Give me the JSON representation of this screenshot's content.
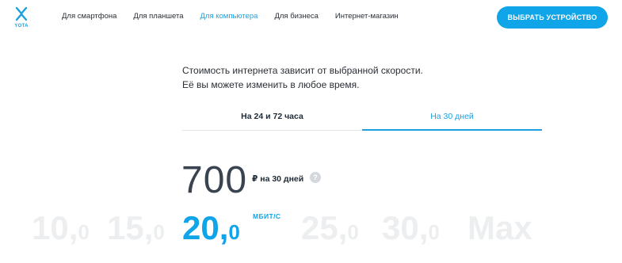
{
  "logo": {
    "text": "YOTA"
  },
  "nav": {
    "items": [
      {
        "label": "Для смартфона",
        "active": false
      },
      {
        "label": "Для планшета",
        "active": false
      },
      {
        "label": "Для компьютера",
        "active": true
      },
      {
        "label": "Для бизнеса",
        "active": false
      },
      {
        "label": "Интернет-магазин",
        "active": false
      }
    ],
    "cta": "ВЫБРАТЬ УСТРОЙСТВО"
  },
  "intro": {
    "line1": "Стоимость интернета зависит от выбранной скорости.",
    "line2": "Её вы можете изменить в любое время."
  },
  "tabs": {
    "tab1": "На 24 и 72 часа",
    "tab2": "На 30 дней",
    "selected": "tab2"
  },
  "price": {
    "value": "700",
    "currency": "₽",
    "period": "на 30 дней",
    "help": "?"
  },
  "speed": {
    "options": [
      {
        "whole": "",
        "frac": "0"
      },
      {
        "whole": "10,",
        "frac": "0"
      },
      {
        "whole": "15,",
        "frac": "0"
      },
      {
        "whole": "20,",
        "frac": "0"
      },
      {
        "whole": "25,",
        "frac": "0"
      },
      {
        "whole": "30,",
        "frac": "0"
      },
      {
        "whole": "Max",
        "frac": ""
      }
    ],
    "selected_index": 3,
    "unit": "МБИТ/С"
  },
  "colors": {
    "accent": "#10a4e8",
    "inactive_speed": "#eceef0",
    "text": "#1f2a36"
  }
}
